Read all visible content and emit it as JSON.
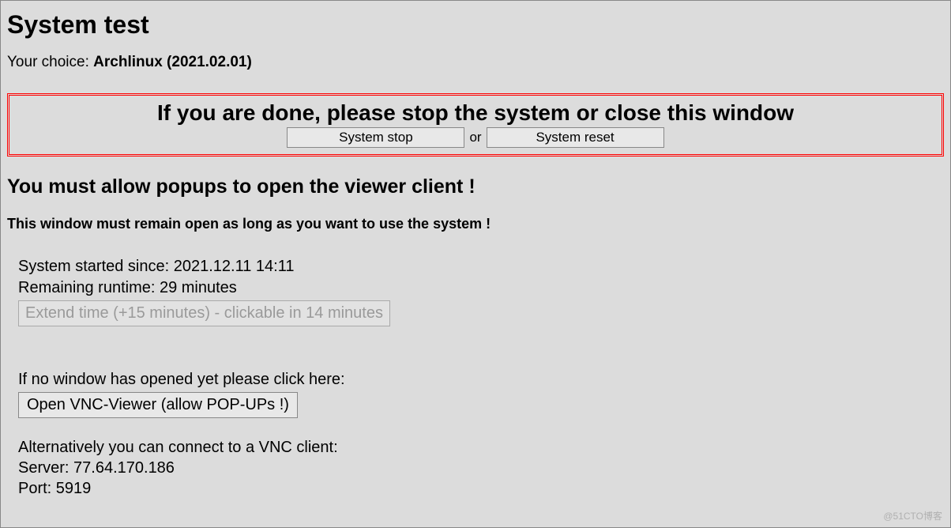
{
  "title": "System test",
  "choice_label": "Your choice: ",
  "choice_value": "Archlinux (2021.02.01)",
  "alert": {
    "heading": "If you are done, please stop the system or close this window",
    "stop_label": "System stop",
    "or_label": "or",
    "reset_label": "System reset"
  },
  "popup_warning": "You must allow popups to open the viewer client !",
  "remain_open": "This window must remain open as long as you want to use the system !",
  "runtime": {
    "started_label": "System started since: ",
    "started_value": "2021.12.11 14:11",
    "remaining_label": "Remaining runtime: ",
    "remaining_value": "29 minutes",
    "extend_label": "Extend time (+15 minutes) - clickable in 14 minutes"
  },
  "vnc": {
    "no_window_text": "If no window has opened yet please click here:",
    "open_label": "Open VNC-Viewer (allow POP-UPs !)",
    "alt_text": "Alternatively you can connect to a VNC client:",
    "server_label": "Server: ",
    "server_value": "77.64.170.186",
    "port_label": "Port: ",
    "port_value": "5919"
  },
  "watermark": "@51CTO博客"
}
